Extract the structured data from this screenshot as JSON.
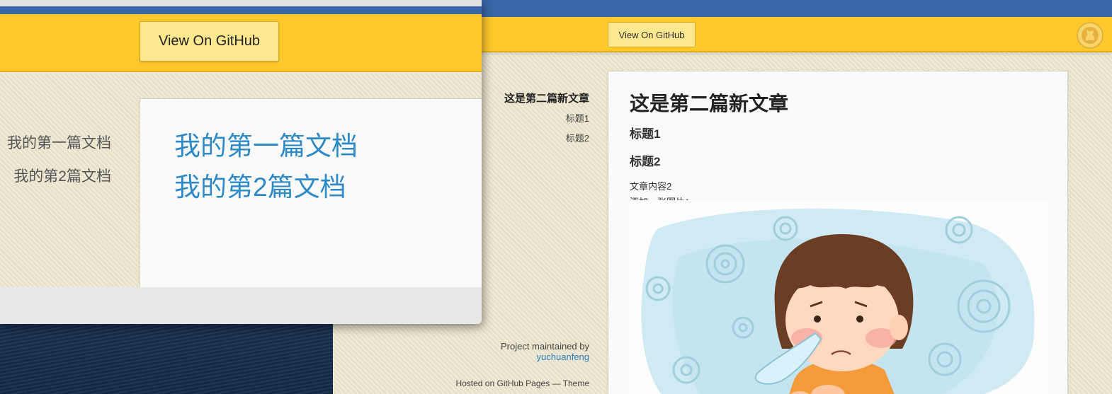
{
  "right_window": {
    "header": {
      "github_button": "View On GitHub",
      "github_logo": "github-octocat"
    },
    "toc": {
      "title": "这是第二篇新文章",
      "items": [
        "标题1",
        "标题2"
      ]
    },
    "sidebar_footer": {
      "maintained_by": "Project maintained by",
      "maintainer": "yuchuanfeng",
      "hosted": "Hosted on GitHub Pages — Theme"
    },
    "article": {
      "title": "这是第二篇新文章",
      "headings": [
        "标题1",
        "标题2"
      ],
      "paragraphs": [
        "文章内容2",
        "添加一张图片："
      ],
      "image": "illustration-girl-with-runny-nose"
    }
  },
  "left_window": {
    "header": {
      "github_button": "View On GitHub"
    },
    "side_links": [
      "我的第一篇文档",
      "我的第2篇文档"
    ],
    "main_links": [
      "我的第一篇文档",
      "我的第2篇文档"
    ]
  },
  "colors": {
    "header_yellow": "#ffc82b",
    "button_yellow": "#fde78f",
    "link_blue": "#2d8ac7",
    "topbar_blue": "#3a66a8"
  }
}
